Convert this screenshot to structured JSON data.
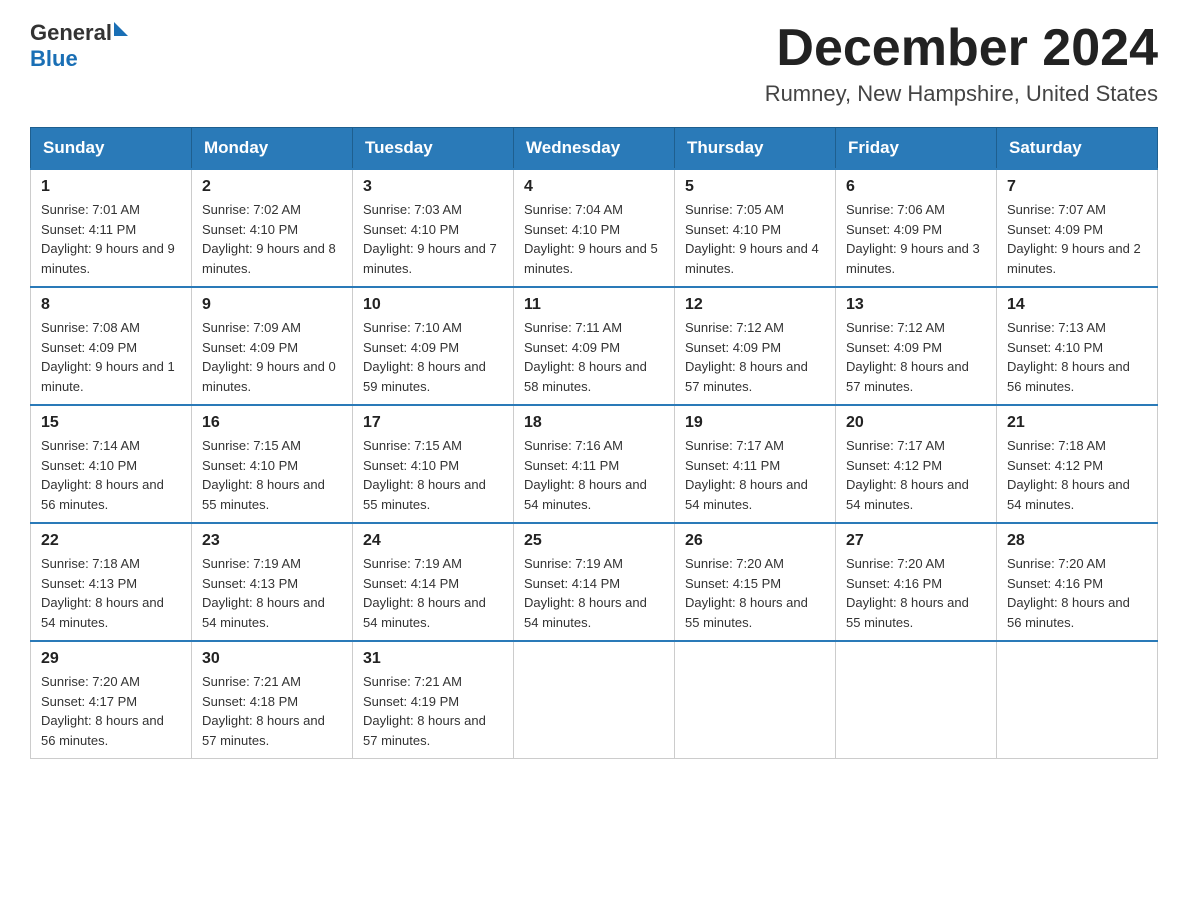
{
  "header": {
    "logo_general": "General",
    "logo_blue": "Blue",
    "month_title": "December 2024",
    "location": "Rumney, New Hampshire, United States"
  },
  "days_of_week": [
    "Sunday",
    "Monday",
    "Tuesday",
    "Wednesday",
    "Thursday",
    "Friday",
    "Saturday"
  ],
  "weeks": [
    [
      {
        "day": "1",
        "sunrise": "7:01 AM",
        "sunset": "4:11 PM",
        "daylight": "9 hours and 9 minutes."
      },
      {
        "day": "2",
        "sunrise": "7:02 AM",
        "sunset": "4:10 PM",
        "daylight": "9 hours and 8 minutes."
      },
      {
        "day": "3",
        "sunrise": "7:03 AM",
        "sunset": "4:10 PM",
        "daylight": "9 hours and 7 minutes."
      },
      {
        "day": "4",
        "sunrise": "7:04 AM",
        "sunset": "4:10 PM",
        "daylight": "9 hours and 5 minutes."
      },
      {
        "day": "5",
        "sunrise": "7:05 AM",
        "sunset": "4:10 PM",
        "daylight": "9 hours and 4 minutes."
      },
      {
        "day": "6",
        "sunrise": "7:06 AM",
        "sunset": "4:09 PM",
        "daylight": "9 hours and 3 minutes."
      },
      {
        "day": "7",
        "sunrise": "7:07 AM",
        "sunset": "4:09 PM",
        "daylight": "9 hours and 2 minutes."
      }
    ],
    [
      {
        "day": "8",
        "sunrise": "7:08 AM",
        "sunset": "4:09 PM",
        "daylight": "9 hours and 1 minute."
      },
      {
        "day": "9",
        "sunrise": "7:09 AM",
        "sunset": "4:09 PM",
        "daylight": "9 hours and 0 minutes."
      },
      {
        "day": "10",
        "sunrise": "7:10 AM",
        "sunset": "4:09 PM",
        "daylight": "8 hours and 59 minutes."
      },
      {
        "day": "11",
        "sunrise": "7:11 AM",
        "sunset": "4:09 PM",
        "daylight": "8 hours and 58 minutes."
      },
      {
        "day": "12",
        "sunrise": "7:12 AM",
        "sunset": "4:09 PM",
        "daylight": "8 hours and 57 minutes."
      },
      {
        "day": "13",
        "sunrise": "7:12 AM",
        "sunset": "4:09 PM",
        "daylight": "8 hours and 57 minutes."
      },
      {
        "day": "14",
        "sunrise": "7:13 AM",
        "sunset": "4:10 PM",
        "daylight": "8 hours and 56 minutes."
      }
    ],
    [
      {
        "day": "15",
        "sunrise": "7:14 AM",
        "sunset": "4:10 PM",
        "daylight": "8 hours and 56 minutes."
      },
      {
        "day": "16",
        "sunrise": "7:15 AM",
        "sunset": "4:10 PM",
        "daylight": "8 hours and 55 minutes."
      },
      {
        "day": "17",
        "sunrise": "7:15 AM",
        "sunset": "4:10 PM",
        "daylight": "8 hours and 55 minutes."
      },
      {
        "day": "18",
        "sunrise": "7:16 AM",
        "sunset": "4:11 PM",
        "daylight": "8 hours and 54 minutes."
      },
      {
        "day": "19",
        "sunrise": "7:17 AM",
        "sunset": "4:11 PM",
        "daylight": "8 hours and 54 minutes."
      },
      {
        "day": "20",
        "sunrise": "7:17 AM",
        "sunset": "4:12 PM",
        "daylight": "8 hours and 54 minutes."
      },
      {
        "day": "21",
        "sunrise": "7:18 AM",
        "sunset": "4:12 PM",
        "daylight": "8 hours and 54 minutes."
      }
    ],
    [
      {
        "day": "22",
        "sunrise": "7:18 AM",
        "sunset": "4:13 PM",
        "daylight": "8 hours and 54 minutes."
      },
      {
        "day": "23",
        "sunrise": "7:19 AM",
        "sunset": "4:13 PM",
        "daylight": "8 hours and 54 minutes."
      },
      {
        "day": "24",
        "sunrise": "7:19 AM",
        "sunset": "4:14 PM",
        "daylight": "8 hours and 54 minutes."
      },
      {
        "day": "25",
        "sunrise": "7:19 AM",
        "sunset": "4:14 PM",
        "daylight": "8 hours and 54 minutes."
      },
      {
        "day": "26",
        "sunrise": "7:20 AM",
        "sunset": "4:15 PM",
        "daylight": "8 hours and 55 minutes."
      },
      {
        "day": "27",
        "sunrise": "7:20 AM",
        "sunset": "4:16 PM",
        "daylight": "8 hours and 55 minutes."
      },
      {
        "day": "28",
        "sunrise": "7:20 AM",
        "sunset": "4:16 PM",
        "daylight": "8 hours and 56 minutes."
      }
    ],
    [
      {
        "day": "29",
        "sunrise": "7:20 AM",
        "sunset": "4:17 PM",
        "daylight": "8 hours and 56 minutes."
      },
      {
        "day": "30",
        "sunrise": "7:21 AM",
        "sunset": "4:18 PM",
        "daylight": "8 hours and 57 minutes."
      },
      {
        "day": "31",
        "sunrise": "7:21 AM",
        "sunset": "4:19 PM",
        "daylight": "8 hours and 57 minutes."
      },
      null,
      null,
      null,
      null
    ]
  ]
}
